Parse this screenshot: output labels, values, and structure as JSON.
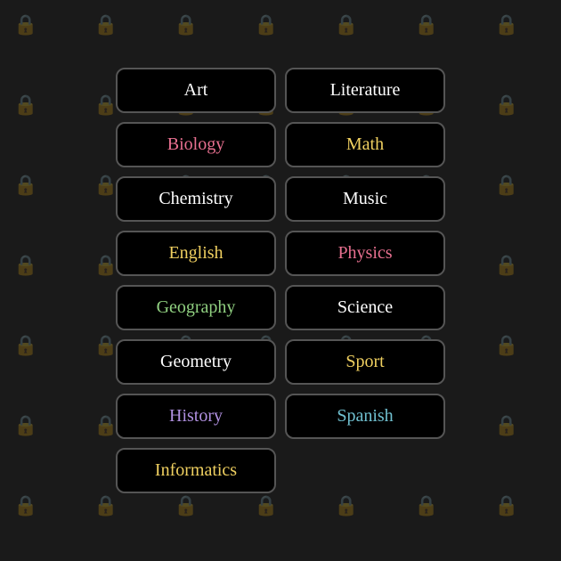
{
  "background": "#1a1a1a",
  "subjects": {
    "left": [
      {
        "label": "Art",
        "colorClass": "color-white"
      },
      {
        "label": "Biology",
        "colorClass": "color-pink"
      },
      {
        "label": "Chemistry",
        "colorClass": "color-white"
      },
      {
        "label": "English",
        "colorClass": "color-yellow"
      },
      {
        "label": "Geography",
        "colorClass": "color-green"
      },
      {
        "label": "Geometry",
        "colorClass": "color-white"
      },
      {
        "label": "History",
        "colorClass": "color-lavender"
      },
      {
        "label": "Informatics",
        "colorClass": "color-yellow"
      }
    ],
    "right": [
      {
        "label": "Literature",
        "colorClass": "color-white"
      },
      {
        "label": "Math",
        "colorClass": "color-yellow"
      },
      {
        "label": "Music",
        "colorClass": "color-white"
      },
      {
        "label": "Physics",
        "colorClass": "color-pink"
      },
      {
        "label": "Science",
        "colorClass": "color-white"
      },
      {
        "label": "Sport",
        "colorClass": "color-yellow"
      },
      {
        "label": "Spanish",
        "colorClass": "color-cyan"
      }
    ]
  }
}
